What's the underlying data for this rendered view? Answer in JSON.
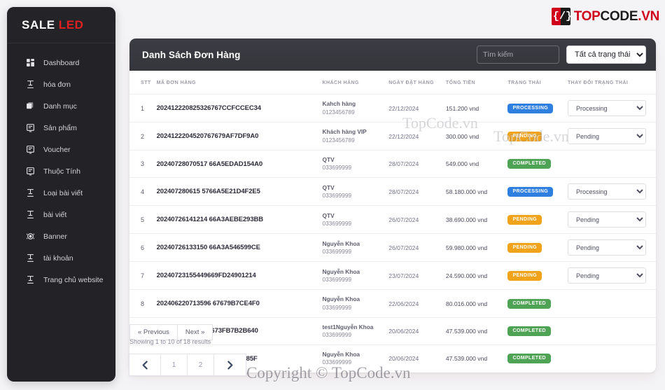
{
  "brand": {
    "name": "SALE",
    "accent_word": "LED",
    "accent_color": "#e02020"
  },
  "sidebar": {
    "items": [
      {
        "label": "Dashboard",
        "icon": "dashboard-grid-icon"
      },
      {
        "label": "hóa đơn",
        "icon": "invoice-icon"
      },
      {
        "label": "Danh mục",
        "icon": "category-layers-icon"
      },
      {
        "label": "Sản phẩm",
        "icon": "product-monitor-icon"
      },
      {
        "label": "Voucher",
        "icon": "voucher-monitor-icon"
      },
      {
        "label": "Thuộc Tính",
        "icon": "attribute-monitor-icon"
      },
      {
        "label": "Loại bài viết",
        "icon": "post-type-icon"
      },
      {
        "label": "bài viết",
        "icon": "post-icon"
      },
      {
        "label": "Banner",
        "icon": "banner-target-icon"
      },
      {
        "label": "tài khoản",
        "icon": "account-icon"
      },
      {
        "label": "Trang chủ website",
        "icon": "homepage-icon"
      }
    ]
  },
  "logo": {
    "mark_left": "{",
    "mark_right": "/}",
    "text_1": "TOP",
    "text_2": "CODE",
    "text_3": ".VN"
  },
  "header": {
    "title": "Danh Sách Đơn Hàng",
    "search_placeholder": "Tìm kiếm",
    "search_value": "",
    "status_filter_selected": "Tất cả trạng thái",
    "status_filter_options": [
      "Tất cả trạng thái",
      "Pending",
      "Processing",
      "Completed"
    ]
  },
  "table": {
    "columns": [
      "STT",
      "MÃ ĐƠN HÀNG",
      "KHÁCH HÀNG",
      "NGÀY ĐẶT HÀNG",
      "TỔNG TIỀN",
      "TRẠNG THÁI",
      "THAY ĐỔI TRẠNG THÁI"
    ],
    "select_options": [
      "Pending",
      "Processing",
      "Completed"
    ],
    "rows": [
      {
        "stt": "1",
        "code": "202412220825326767CCFCCEC34",
        "customer": "Kahch hàng",
        "phone": "0123456789",
        "date": "22/12/2024",
        "total": "151.200 vnd",
        "status": "PROCESSING",
        "status_class": "processing",
        "select": "Processing"
      },
      {
        "stt": "2",
        "code": "2024122204520767679AF7DF9A0",
        "customer": "Khách hàng VIP",
        "phone": "0123456789",
        "date": "22/12/2024",
        "total": "300.000 vnd",
        "status": "PENDING",
        "status_class": "pending",
        "select": "Pending"
      },
      {
        "stt": "3",
        "code": "20240728070517 66A5EDAD154A0",
        "customer": "QTV",
        "phone": "033699999",
        "date": "28/07/2024",
        "total": "549.000 vnd",
        "status": "COMPLETED",
        "status_class": "completed",
        "select": ""
      },
      {
        "stt": "4",
        "code": "202407280615 5766A5E21D4F2E5",
        "customer": "QTV",
        "phone": "033699999",
        "date": "28/07/2024",
        "total": "58.180.000 vnd",
        "status": "PROCESSING",
        "status_class": "processing",
        "select": "Processing"
      },
      {
        "stt": "5",
        "code": "20240726141214 66A3AEBE293BB",
        "customer": "QTV",
        "phone": "033699999",
        "date": "26/07/2024",
        "total": "38.690.000 vnd",
        "status": "PENDING",
        "status_class": "pending",
        "select": "Pending"
      },
      {
        "stt": "6",
        "code": "20240726133150 66A3A546599CE",
        "customer": "Nguyễn Khoa",
        "phone": "033699999",
        "date": "26/07/2024",
        "total": "59.980.000 vnd",
        "status": "PENDING",
        "status_class": "pending",
        "select": "Pending"
      },
      {
        "stt": "7",
        "code": "20240723155449669FD24901214",
        "customer": "Nguyễn Khoa",
        "phone": "033699999",
        "date": "23/07/2024",
        "total": "24.590.000 vnd",
        "status": "PENDING",
        "status_class": "pending",
        "select": "Pending"
      },
      {
        "stt": "8",
        "code": "202406220713596 67679B7CE4F0",
        "customer": "Nguyễn Khoa",
        "phone": "033699999",
        "date": "22/06/2024",
        "total": "80.016.000 vnd",
        "status": "COMPLETED",
        "status_class": "completed",
        "select": ""
      },
      {
        "stt": "9",
        "code": "202406200950516673FB7B2B640",
        "customer": "test1Nguyễn Khoa",
        "phone": "033699999",
        "date": "20/06/2024",
        "total": "47.539.000 vnd",
        "status": "COMPLETED",
        "status_class": "completed",
        "select": ""
      },
      {
        "stt": "10",
        "code": "202406200950106673FB525B85F",
        "customer": "Nguyễn Khoa",
        "phone": "033699999",
        "date": "20/06/2024",
        "total": "47.539.000 vnd",
        "status": "COMPLETED",
        "status_class": "completed",
        "select": ""
      }
    ]
  },
  "pagination": {
    "previous": "« Previous",
    "next": "Next »",
    "results_text": "Showing 1 to 10 of 18 results",
    "pages": [
      "1",
      "2"
    ],
    "prev_icon": "chevron-left-icon",
    "next_icon": "chevron-right-icon"
  },
  "watermarks": {
    "wm_1": "TopCode.vn",
    "wm_2": "TopCode.vn",
    "wm_3": "Copyright © TopCode.vn"
  }
}
